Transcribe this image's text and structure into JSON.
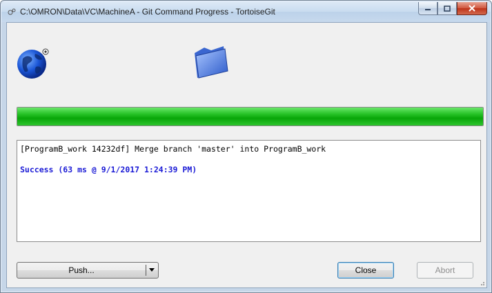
{
  "window": {
    "title": "C:\\OMRON\\Data\\VC\\MachineA - Git Command Progress - TortoiseGit"
  },
  "progress": {
    "fraction": 1.0,
    "color": "#16b316"
  },
  "log": {
    "lines": [
      "[ProgramB_work 14232df] Merge branch 'master' into ProgramB_work"
    ],
    "success": "Success (63 ms @ 9/1/2017 1:24:39 PM)"
  },
  "buttons": {
    "push": "Push...",
    "close": "Close",
    "abort": "Abort"
  },
  "colors": {
    "success_text": "#1b1bd6",
    "close_button": "#c8412a"
  }
}
